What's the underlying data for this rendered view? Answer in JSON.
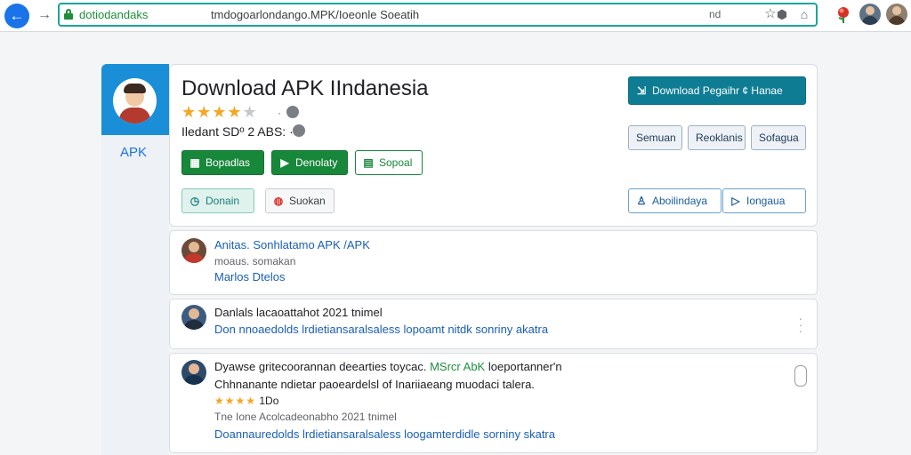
{
  "browser": {
    "url_domain": "dotiodandaks",
    "url_path": "tmdogoarlondango.MPK/Ioeonle Soeatih",
    "address_action": "nd"
  },
  "rail": {
    "label": "APK"
  },
  "app": {
    "title": "Download APK IIndanesia",
    "rating_stars": 4,
    "rating_separator": "·",
    "meta": "Iledant SDº 2 ABS: ·",
    "buttons": {
      "primary_1": "Bopadlas",
      "primary_2": "Denolaty",
      "outline": "Sopoal",
      "teal": "Donain",
      "gray": "Suokan",
      "download_regular": "Download Pegaihr ¢ Hanae",
      "chip_1": "Semuan",
      "chip_2": "Reoklanis",
      "chip_3": "Sofagua",
      "action_1": "Aboilindaya",
      "action_2": "Iongaua"
    }
  },
  "items": [
    {
      "line1": "Anitas. Sonhlatamo  APK /APK",
      "line2": "moaus. somakan",
      "line3": "Marlos Dtelos"
    },
    {
      "line1": "Danlals lacaoattahot 2021 tnimel",
      "line2": "Don nnoaedolds lrdietiansaralsaless lopoamt nitdk sonriny akatra"
    },
    {
      "line1_a": "Dyawse gritecoorannan deearties toycac.",
      "line1_b": "MSrcr AbK",
      "line1_c": "loeportanner'n",
      "line2": "Chhnanante ndietar paoeardelsl of Inariiaeang muodaci talera.",
      "rating": "1Do",
      "line3": "Tne Ione Acolcadeonabho 2021 tnimel",
      "line4": "Doannauredolds lrdietiansaralsaless loogamterdidle sorniny skatra"
    }
  ],
  "colors": {
    "accent": "#1a73e8",
    "primary": "#0e7d94",
    "success": "#17873a",
    "star": "#f5a623"
  },
  "icons": [
    "back-arrow-icon",
    "forward-arrow-icon",
    "lock-icon",
    "star-icon",
    "extension-icon",
    "flower-icon",
    "profile-avatar-icon",
    "refresh-icon",
    "download-icon",
    "play-icon",
    "user-icon",
    "more-icon"
  ]
}
